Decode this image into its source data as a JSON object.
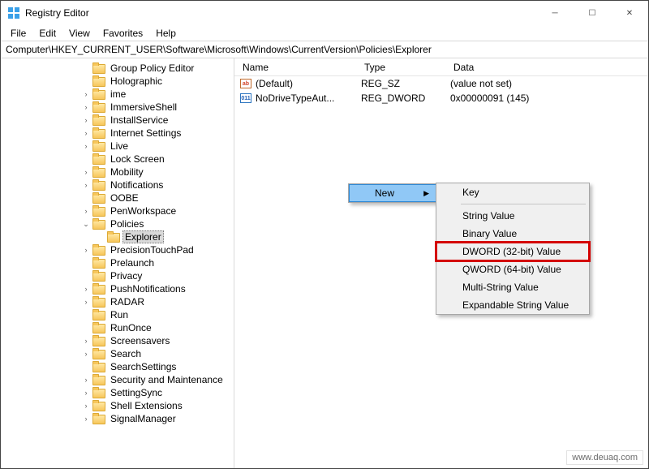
{
  "window": {
    "title": "Registry Editor"
  },
  "menubar": [
    "File",
    "Edit",
    "View",
    "Favorites",
    "Help"
  ],
  "address": "Computer\\HKEY_CURRENT_USER\\Software\\Microsoft\\Windows\\CurrentVersion\\Policies\\Explorer",
  "tree": {
    "items": [
      {
        "label": "Group Policy Editor",
        "depth": 1,
        "caret": "none"
      },
      {
        "label": "Holographic",
        "depth": 1,
        "caret": "none"
      },
      {
        "label": "ime",
        "depth": 1,
        "caret": "closed"
      },
      {
        "label": "ImmersiveShell",
        "depth": 1,
        "caret": "closed"
      },
      {
        "label": "InstallService",
        "depth": 1,
        "caret": "closed"
      },
      {
        "label": "Internet Settings",
        "depth": 1,
        "caret": "closed"
      },
      {
        "label": "Live",
        "depth": 1,
        "caret": "closed"
      },
      {
        "label": "Lock Screen",
        "depth": 1,
        "caret": "none"
      },
      {
        "label": "Mobility",
        "depth": 1,
        "caret": "closed"
      },
      {
        "label": "Notifications",
        "depth": 1,
        "caret": "closed"
      },
      {
        "label": "OOBE",
        "depth": 1,
        "caret": "none"
      },
      {
        "label": "PenWorkspace",
        "depth": 1,
        "caret": "closed"
      },
      {
        "label": "Policies",
        "depth": 1,
        "caret": "open"
      },
      {
        "label": "Explorer",
        "depth": 2,
        "caret": "none",
        "selected": true
      },
      {
        "label": "PrecisionTouchPad",
        "depth": 1,
        "caret": "closed"
      },
      {
        "label": "Prelaunch",
        "depth": 1,
        "caret": "none"
      },
      {
        "label": "Privacy",
        "depth": 1,
        "caret": "none"
      },
      {
        "label": "PushNotifications",
        "depth": 1,
        "caret": "closed"
      },
      {
        "label": "RADAR",
        "depth": 1,
        "caret": "closed"
      },
      {
        "label": "Run",
        "depth": 1,
        "caret": "none"
      },
      {
        "label": "RunOnce",
        "depth": 1,
        "caret": "none"
      },
      {
        "label": "Screensavers",
        "depth": 1,
        "caret": "closed"
      },
      {
        "label": "Search",
        "depth": 1,
        "caret": "closed"
      },
      {
        "label": "SearchSettings",
        "depth": 1,
        "caret": "none"
      },
      {
        "label": "Security and Maintenance",
        "depth": 1,
        "caret": "closed"
      },
      {
        "label": "SettingSync",
        "depth": 1,
        "caret": "closed"
      },
      {
        "label": "Shell Extensions",
        "depth": 1,
        "caret": "closed"
      },
      {
        "label": "SignalManager",
        "depth": 1,
        "caret": "closed"
      }
    ]
  },
  "list": {
    "columns": {
      "name": "Name",
      "type": "Type",
      "data": "Data"
    },
    "rows": [
      {
        "icon": "reg-sz",
        "name": "(Default)",
        "type": "REG_SZ",
        "data": "(value not set)"
      },
      {
        "icon": "reg-dword",
        "name": "NoDriveTypeAut...",
        "type": "REG_DWORD",
        "data": "0x00000091 (145)"
      }
    ]
  },
  "contextMenu": {
    "parent": {
      "label": "New"
    },
    "submenu": [
      {
        "label": "Key",
        "sepAfter": true
      },
      {
        "label": "String Value"
      },
      {
        "label": "Binary Value"
      },
      {
        "label": "DWORD (32-bit) Value",
        "highlight": true
      },
      {
        "label": "QWORD (64-bit) Value"
      },
      {
        "label": "Multi-String Value"
      },
      {
        "label": "Expandable String Value"
      }
    ]
  },
  "watermark": "www.deuaq.com"
}
